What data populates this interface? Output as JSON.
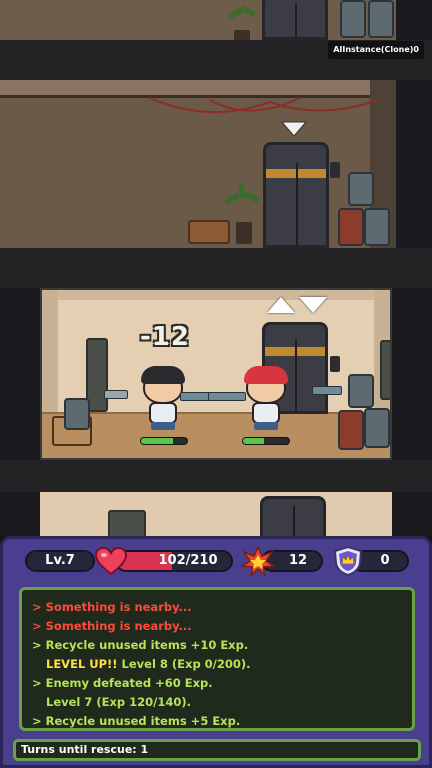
{
  "scene": {
    "instance_label": "AIInstance(Clone)0",
    "damage_text": "-12",
    "player_hp_fraction": 0.7,
    "enemy_hp_fraction": 0.45
  },
  "hud": {
    "level": "Lv.7",
    "hp_current": "102",
    "hp_separator": "/",
    "hp_max": "210",
    "hp_fraction": 0.486,
    "bombs": "12",
    "rescued": "0",
    "colors": {
      "panel": "#4a3f8f",
      "hp_fill": "#d73451",
      "log_red": "#ff4a3a",
      "log_green": "#b7e35a",
      "log_yellow": "#ffe046",
      "log_border": "#6aa14a"
    },
    "icons": [
      "heart-icon",
      "explosion-icon",
      "shield-crown-icon"
    ]
  },
  "log": [
    {
      "color": "red",
      "text": "> Something is nearby..."
    },
    {
      "color": "red",
      "text": "> Something is nearby..."
    },
    {
      "color": "green",
      "text": "> Recycle unused items +10 Exp."
    },
    {
      "color": "green",
      "highlight": "LEVEL UP!!",
      "text": " Level 8 (Exp 0/200)."
    },
    {
      "color": "green",
      "text": "> Enemy defeated +60 Exp."
    },
    {
      "color": "green",
      "text": "Level 7 (Exp 120/140)."
    },
    {
      "color": "green",
      "text": "> Recycle unused items +5 Exp."
    }
  ],
  "status": {
    "rescue_label": "Turns until rescue:",
    "rescue_turns": "1"
  }
}
